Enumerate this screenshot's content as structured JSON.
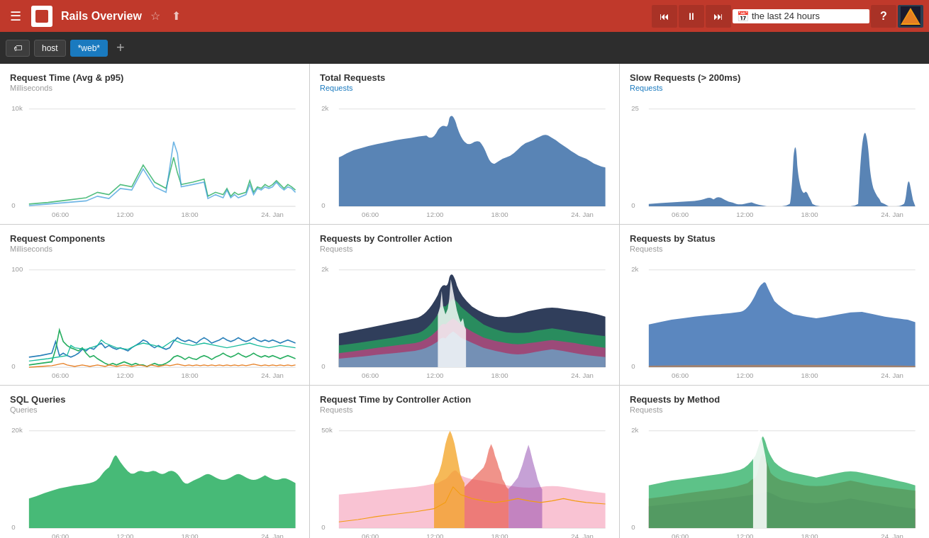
{
  "topnav": {
    "title": "Rails Overview",
    "time_value": "the last 24 hours",
    "time_placeholder": "the last 24 hours",
    "help_label": "?",
    "back_label": "⏮",
    "pause_label": "⏸",
    "forward_label": "⏭"
  },
  "filterbar": {
    "add_label": "+",
    "filters": [
      {
        "label": "host",
        "active": false
      },
      {
        "label": "*web*",
        "active": true
      }
    ]
  },
  "panels": [
    {
      "id": "request-time",
      "title": "Request Time (Avg & p95)",
      "subtitle": "Milliseconds",
      "subtitle_link": false,
      "y_max": "10k",
      "y_zero": "0",
      "x_labels": [
        "06:00",
        "12:00",
        "18:00",
        "24. Jan"
      ],
      "chart_type": "line_multi"
    },
    {
      "id": "total-requests",
      "title": "Total Requests",
      "subtitle": "Requests",
      "subtitle_link": true,
      "y_max": "2k",
      "y_zero": "0",
      "x_labels": [
        "06:00",
        "12:00",
        "18:00",
        "24. Jan"
      ],
      "chart_type": "area_blue"
    },
    {
      "id": "slow-requests",
      "title": "Slow Requests (> 200ms)",
      "subtitle": "Requests",
      "subtitle_link": true,
      "y_max": "25",
      "y_zero": "0",
      "x_labels": [
        "06:00",
        "12:00",
        "18:00",
        "24. Jan"
      ],
      "chart_type": "area_blue_sparse"
    },
    {
      "id": "request-components",
      "title": "Request Components",
      "subtitle": "Milliseconds",
      "subtitle_link": false,
      "y_max": "100",
      "y_zero": "0",
      "x_labels": [
        "06:00",
        "12:00",
        "18:00",
        "24. Jan"
      ],
      "chart_type": "line_multi_color"
    },
    {
      "id": "requests-by-controller",
      "title": "Requests by Controller Action",
      "subtitle": "Requests",
      "subtitle_link": false,
      "y_max": "2k",
      "y_zero": "0",
      "x_labels": [
        "06:00",
        "12:00",
        "18:00",
        "24. Jan"
      ],
      "chart_type": "area_stacked_multi"
    },
    {
      "id": "requests-by-status",
      "title": "Requests by Status",
      "subtitle": "Requests",
      "subtitle_link": false,
      "y_max": "2k",
      "y_zero": "0",
      "x_labels": [
        "06:00",
        "12:00",
        "18:00",
        "24. Jan"
      ],
      "chart_type": "area_blue_status"
    },
    {
      "id": "sql-queries",
      "title": "SQL Queries",
      "subtitle": "Queries",
      "subtitle_link": false,
      "y_max": "20k",
      "y_zero": "0",
      "x_labels": [
        "06:00",
        "12:00",
        "18:00",
        "24. Jan"
      ],
      "chart_type": "area_green"
    },
    {
      "id": "request-time-controller",
      "title": "Request Time by Controller Action",
      "subtitle": "Requests",
      "subtitle_link": false,
      "y_max": "50k",
      "y_zero": "0",
      "x_labels": [
        "06:00",
        "12:00",
        "18:00",
        "24. Jan"
      ],
      "chart_type": "area_stacked_pastel"
    },
    {
      "id": "requests-by-method",
      "title": "Requests by Method",
      "subtitle": "Requests",
      "subtitle_link": false,
      "y_max": "2k",
      "y_zero": "0",
      "x_labels": [
        "06:00",
        "12:00",
        "18:00",
        "24. Jan"
      ],
      "chart_type": "area_stacked_method"
    }
  ]
}
